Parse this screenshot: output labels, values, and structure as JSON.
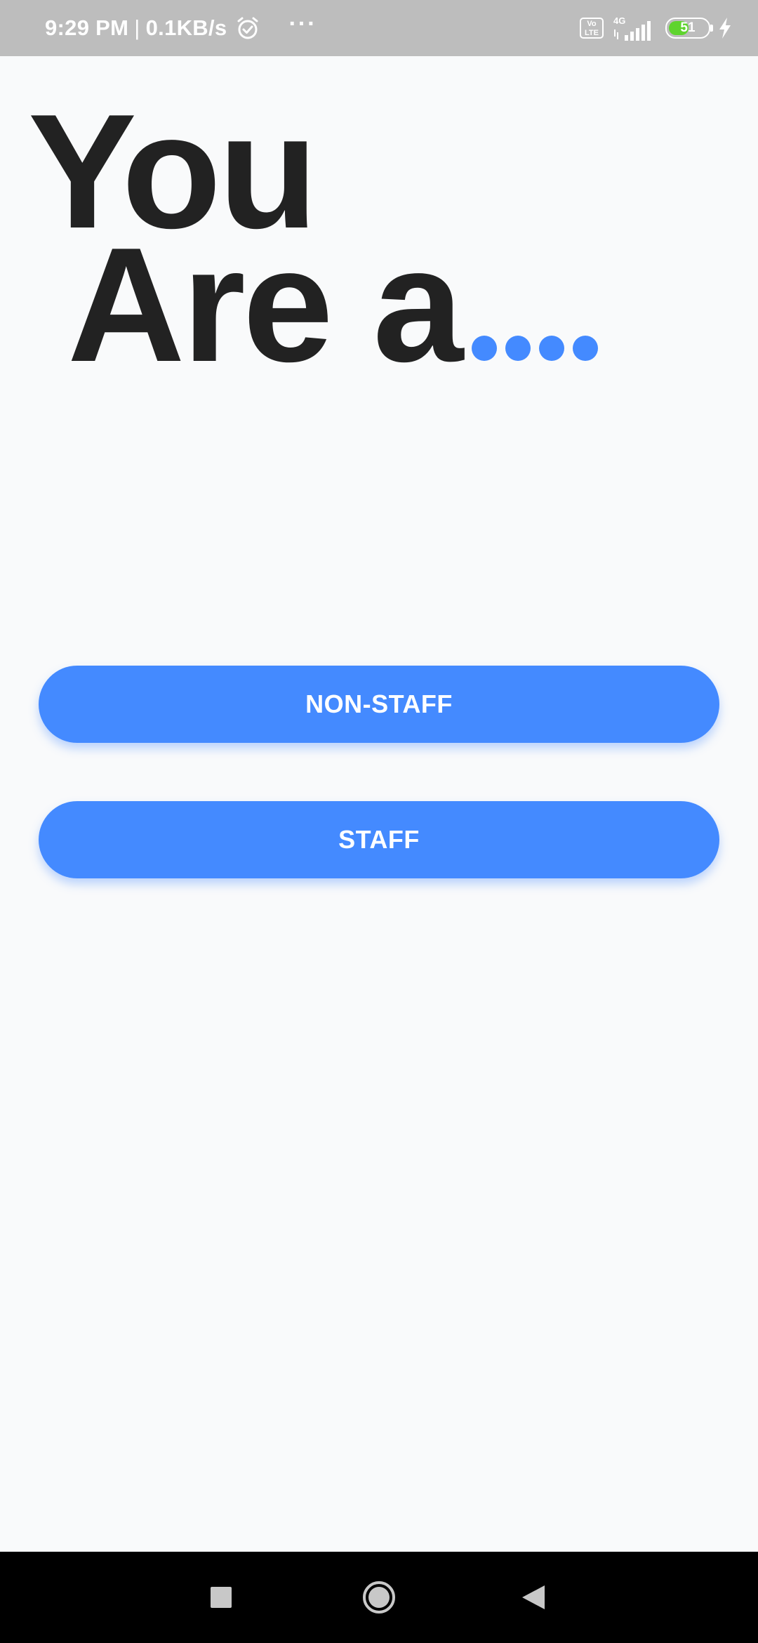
{
  "status_bar": {
    "time": "9:29 PM",
    "separator": "|",
    "network_speed": "0.1KB/s",
    "more": "···",
    "volte_line1": "Vo",
    "volte_line2": "LTE",
    "network_type": "4G",
    "battery_level": "51",
    "battery_fraction": 0.51,
    "icons": [
      "alarm-icon",
      "more-icon",
      "volte-icon",
      "signal-icon",
      "battery-icon",
      "charging-bolt-icon"
    ],
    "battery_color": "#5fd42e"
  },
  "heading": {
    "line1": "You",
    "line2": "Are a"
  },
  "buttons": {
    "non_staff": "NON-STAFF",
    "staff": "STAFF"
  },
  "nav_bar": {
    "icons": [
      "recents-icon",
      "home-icon",
      "back-icon"
    ]
  },
  "colors": {
    "accent": "#448aff",
    "heading_text": "#222222",
    "background": "#f9fafb",
    "status_bar": "#bdbdbd",
    "nav_bar": "#000000"
  }
}
